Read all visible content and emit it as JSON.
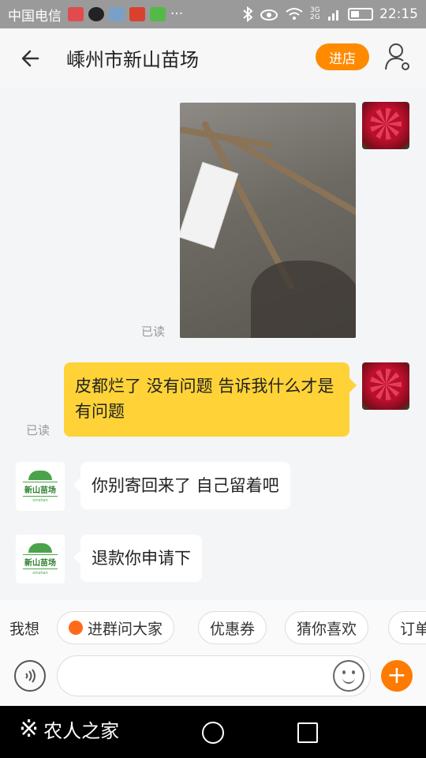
{
  "status_bar": {
    "carrier": "中国电信",
    "overflow": "···",
    "network": "3G 2G",
    "time": "22:15",
    "icons": [
      "notification-icon",
      "qq-icon",
      "gallery-icon",
      "app-icon",
      "diy-icon",
      "bluetooth-icon",
      "eye-icon",
      "wifi-icon",
      "signal-icon",
      "battery-icon"
    ]
  },
  "header": {
    "title": "嵊州市新山苗场",
    "shop_button": "进店"
  },
  "chat": {
    "messages": [
      {
        "from": "me",
        "type": "image",
        "read": "已读"
      },
      {
        "from": "me",
        "type": "text",
        "text": "皮都烂了  没有问题  告诉我什么才是有问题",
        "read": "已读"
      },
      {
        "from": "shop",
        "type": "text",
        "text": "你别寄回来了  自己留着吧"
      },
      {
        "from": "shop",
        "type": "text",
        "text": "退款你申请下"
      }
    ],
    "shop_avatar_text": "新山苗场",
    "shop_avatar_sub": "xinshan"
  },
  "quick_bar": {
    "label": "我想",
    "chips": [
      "进群问大家",
      "优惠券",
      "猜你喜欢",
      "订单"
    ]
  },
  "input": {
    "placeholder": ""
  },
  "watermark": {
    "text": "农人之家"
  },
  "colors": {
    "accent": "#ff8a00",
    "my_bubble": "#ffd337",
    "their_bubble": "#ffffff"
  }
}
